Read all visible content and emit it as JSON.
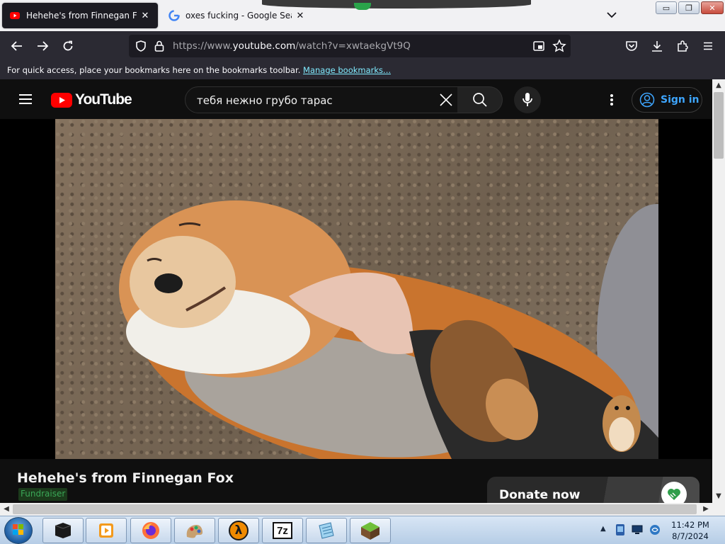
{
  "browser": {
    "tabs": [
      {
        "title": "Hehehe's from Finnegan Fox -",
        "active": true,
        "favicon": "youtube-icon"
      },
      {
        "title": "oxes fucking - Google Search",
        "active": false,
        "favicon": "google-icon"
      }
    ],
    "window_controls": {
      "minimize": "▭",
      "maximize": "❐",
      "close": "✕"
    },
    "url": {
      "prefix": "https://www.",
      "host": "youtube.com",
      "path": "/watch?v=xwtaekgVt9Q"
    },
    "bookmarks": {
      "message": "For quick access, place your bookmarks here on the bookmarks toolbar.",
      "link": "Manage bookmarks..."
    }
  },
  "youtube": {
    "logo_text": "YouTube",
    "search_value": "тебя нежно грубо тарас",
    "sign_in_label": "Sign in",
    "video": {
      "title": "Hehehe's from Finnegan Fox",
      "badge": "Fundraiser",
      "donate_label": "Donate now"
    }
  },
  "taskbar": {
    "apps": [
      "terminal-icon",
      "media-player-icon",
      "firefox-icon",
      "paint-icon",
      "half-life-icon",
      "7zip-icon",
      "notepad-icon",
      "minecraft-icon"
    ],
    "clock": {
      "time": "11:42 PM",
      "date": "8/7/2024"
    },
    "seven_zip_label": "7z",
    "half_life_label": "λ"
  },
  "colors": {
    "yt_red": "#ff0000",
    "link_blue": "#3ea6ff",
    "toolbar": "#2b2a33",
    "fundraiser_green": "#3aa757"
  }
}
